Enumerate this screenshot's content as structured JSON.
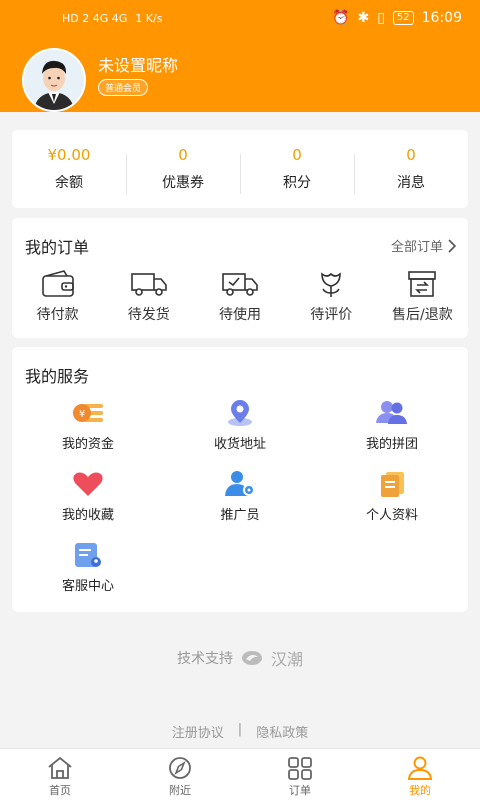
{
  "status": {
    "network": "HD 2  4G  4G",
    "speed": "1 K/s",
    "battery": "52",
    "time": "16:09"
  },
  "profile": {
    "nickname": "未设置昵称",
    "member_level": "普通会员"
  },
  "wallet": [
    {
      "value": "¥0.00",
      "label": "余额"
    },
    {
      "value": "0",
      "label": "优惠券"
    },
    {
      "value": "0",
      "label": "积分"
    },
    {
      "value": "0",
      "label": "消息"
    }
  ],
  "orders": {
    "title": "我的订单",
    "all_label": "全部订单",
    "items": [
      {
        "label": "待付款",
        "icon": "wallet-icon"
      },
      {
        "label": "待发货",
        "icon": "truck-icon"
      },
      {
        "label": "待使用",
        "icon": "truck-check-icon"
      },
      {
        "label": "待评价",
        "icon": "flower-icon"
      },
      {
        "label": "售后/退款",
        "icon": "return-box-icon"
      }
    ]
  },
  "services": {
    "title": "我的服务",
    "items": [
      {
        "label": "我的资金",
        "icon": "coin-icon"
      },
      {
        "label": "收货地址",
        "icon": "location-icon"
      },
      {
        "label": "我的拼团",
        "icon": "group-icon"
      },
      {
        "label": "我的收藏",
        "icon": "heart-icon"
      },
      {
        "label": "推广员",
        "icon": "promoter-icon"
      },
      {
        "label": "个人资料",
        "icon": "profile-doc-icon"
      },
      {
        "label": "客服中心",
        "icon": "service-icon"
      }
    ]
  },
  "footer": {
    "tech_support": "技术支持",
    "brand": "汉潮",
    "agreement": "注册协议",
    "divider": "|",
    "privacy": "隐私政策"
  },
  "tabs": [
    {
      "label": "首页",
      "icon": "home-icon"
    },
    {
      "label": "附近",
      "icon": "compass-icon"
    },
    {
      "label": "订单",
      "icon": "grid-icon"
    },
    {
      "label": "我的",
      "icon": "user-icon"
    }
  ],
  "colors": {
    "brand": "#ff9500",
    "accent_value": "#f0a000"
  }
}
